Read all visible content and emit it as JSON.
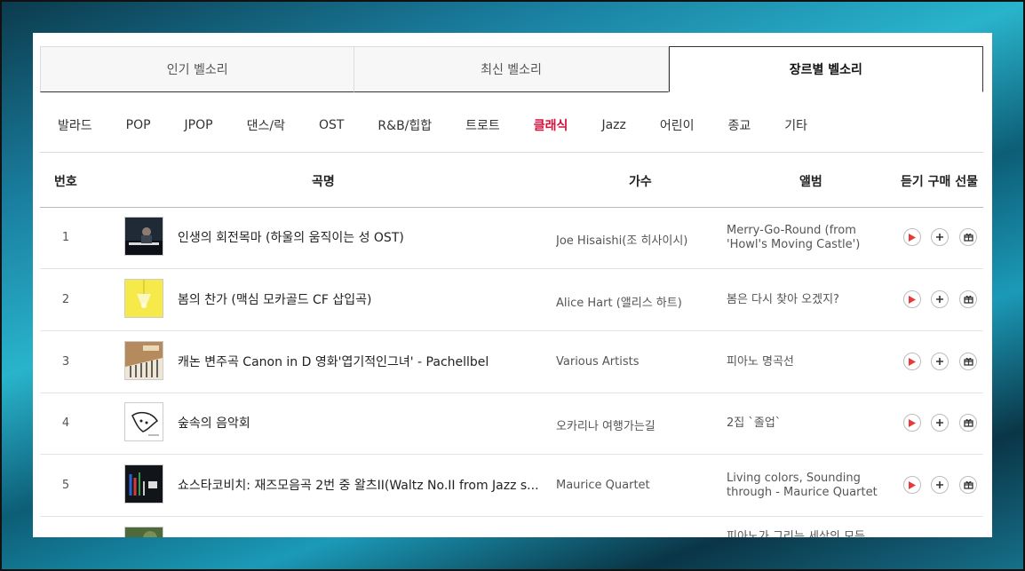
{
  "tabs": [
    "인기 벨소리",
    "최신 벨소리",
    "장르별 벨소리"
  ],
  "genres": [
    "발라드",
    "POP",
    "JPOP",
    "댄스/락",
    "OST",
    "R&B/힙합",
    "트로트",
    "클래식",
    "Jazz",
    "어린이",
    "종교",
    "기타"
  ],
  "header": {
    "num": "번호",
    "title": "곡명",
    "artist": "가수",
    "album": "앨범",
    "actions": "듣기 구매 선물"
  },
  "colors": {
    "accent": "#d6103b",
    "play": "#e83a3a"
  },
  "rows": [
    {
      "num": "1",
      "title": "인생의 회전목마 (하울의 움직이는 성 OST)",
      "artist": "Joe Hisaishi(조 히사이시)",
      "album_lines": [
        "Merry-Go-Round (from",
        "'Howl's Moving Castle')"
      ]
    },
    {
      "num": "2",
      "title": "봄의 찬가 (맥심 모카골드 CF 삽입곡)",
      "artist": "Alice Hart (앨리스 하트)",
      "album_lines": [
        "봄은 다시 찾아 오겠지?"
      ]
    },
    {
      "num": "3",
      "title": "캐논 변주곡 Canon in D 영화'엽기적인그녀' - Pachellbel",
      "artist": "Various Artists",
      "album_lines": [
        "피아노 명곡선"
      ]
    },
    {
      "num": "4",
      "title": "숲속의 음악회",
      "artist": "오카리나 여행가는길",
      "album_lines": [
        "2집 `졸업`"
      ]
    },
    {
      "num": "5",
      "title": "쇼스타코비치: 재즈모음곡 2번 중 왈츠II(Waltz No.II from Jazz s...",
      "artist": "Maurice Quartet",
      "album_lines": [
        "Living colors, Sounding",
        "through - Maurice Quartet"
      ]
    },
    {
      "num": "",
      "title": "",
      "artist": "",
      "album_lines": [
        "피아노가 그리는 세상의 모든"
      ]
    }
  ]
}
